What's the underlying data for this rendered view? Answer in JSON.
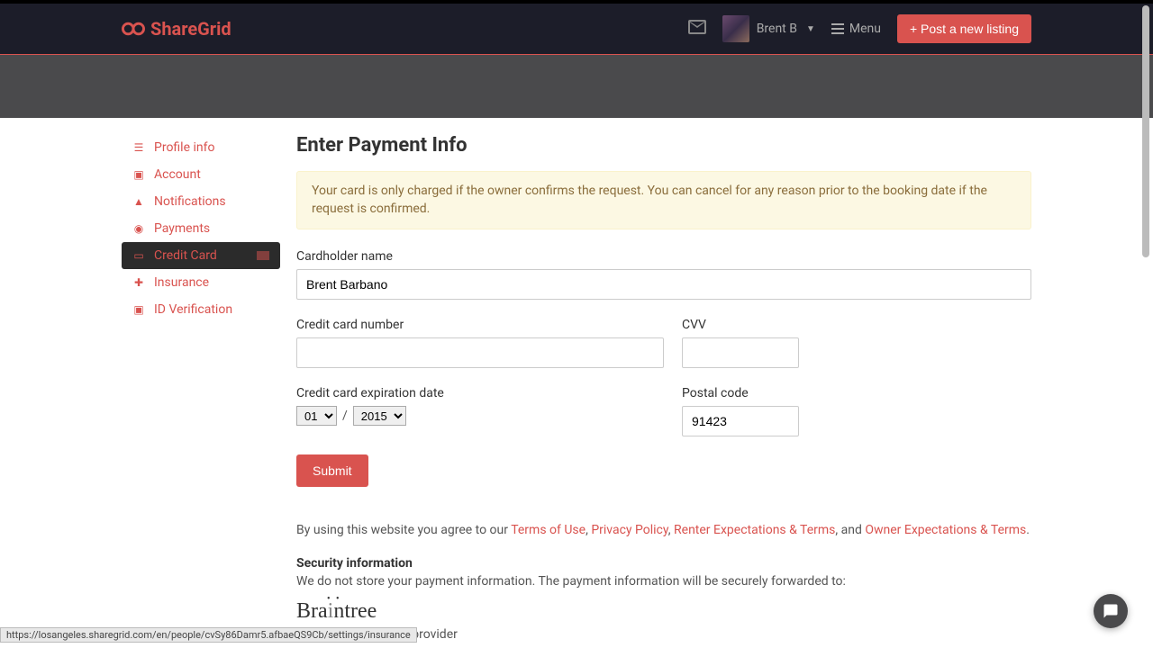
{
  "brand": "ShareGrid",
  "header": {
    "user_name": "Brent B",
    "menu_label": "Menu",
    "post_button": "+ Post a new listing"
  },
  "sidebar": {
    "items": [
      {
        "label": "Profile info",
        "icon": "user-icon"
      },
      {
        "label": "Account",
        "icon": "card-icon"
      },
      {
        "label": "Notifications",
        "icon": "bell-icon"
      },
      {
        "label": "Payments",
        "icon": "money-icon"
      },
      {
        "label": "Credit Card",
        "icon": "credit-card-icon",
        "active": true
      },
      {
        "label": "Insurance",
        "icon": "plus-icon"
      },
      {
        "label": "ID Verification",
        "icon": "id-icon"
      }
    ]
  },
  "page": {
    "title": "Enter Payment Info",
    "alert": "Your card is only charged if the owner confirms the request. You can cancel for any reason prior to the booking date if the request is confirmed.",
    "labels": {
      "cardholder": "Cardholder name",
      "cc_number": "Credit card number",
      "cvv": "CVV",
      "exp": "Credit card expiration date",
      "postal": "Postal code"
    },
    "values": {
      "cardholder": "Brent Barbano",
      "cc_number": "",
      "cvv": "",
      "exp_month": "01",
      "exp_year": "2015",
      "postal": "91423"
    },
    "submit": "Submit",
    "legal_prefix": "By using this website you agree to our ",
    "legal_links": {
      "terms": "Terms of Use",
      "privacy": "Privacy Policy",
      "renter": "Renter Expectations & Terms",
      "owner": "Owner Expectations & Terms"
    },
    "legal_and": ", and ",
    "security_title": "Security information",
    "security_text": "We do not store your payment information. The payment information will be securely forwarded to:",
    "provider_name": "Braintree",
    "provider_sub": "Our secure payment provider"
  },
  "status_url": "https://losangeles.sharegrid.com/en/people/cvSy86Damr5.afbaeQS9Cb/settings/insurance"
}
